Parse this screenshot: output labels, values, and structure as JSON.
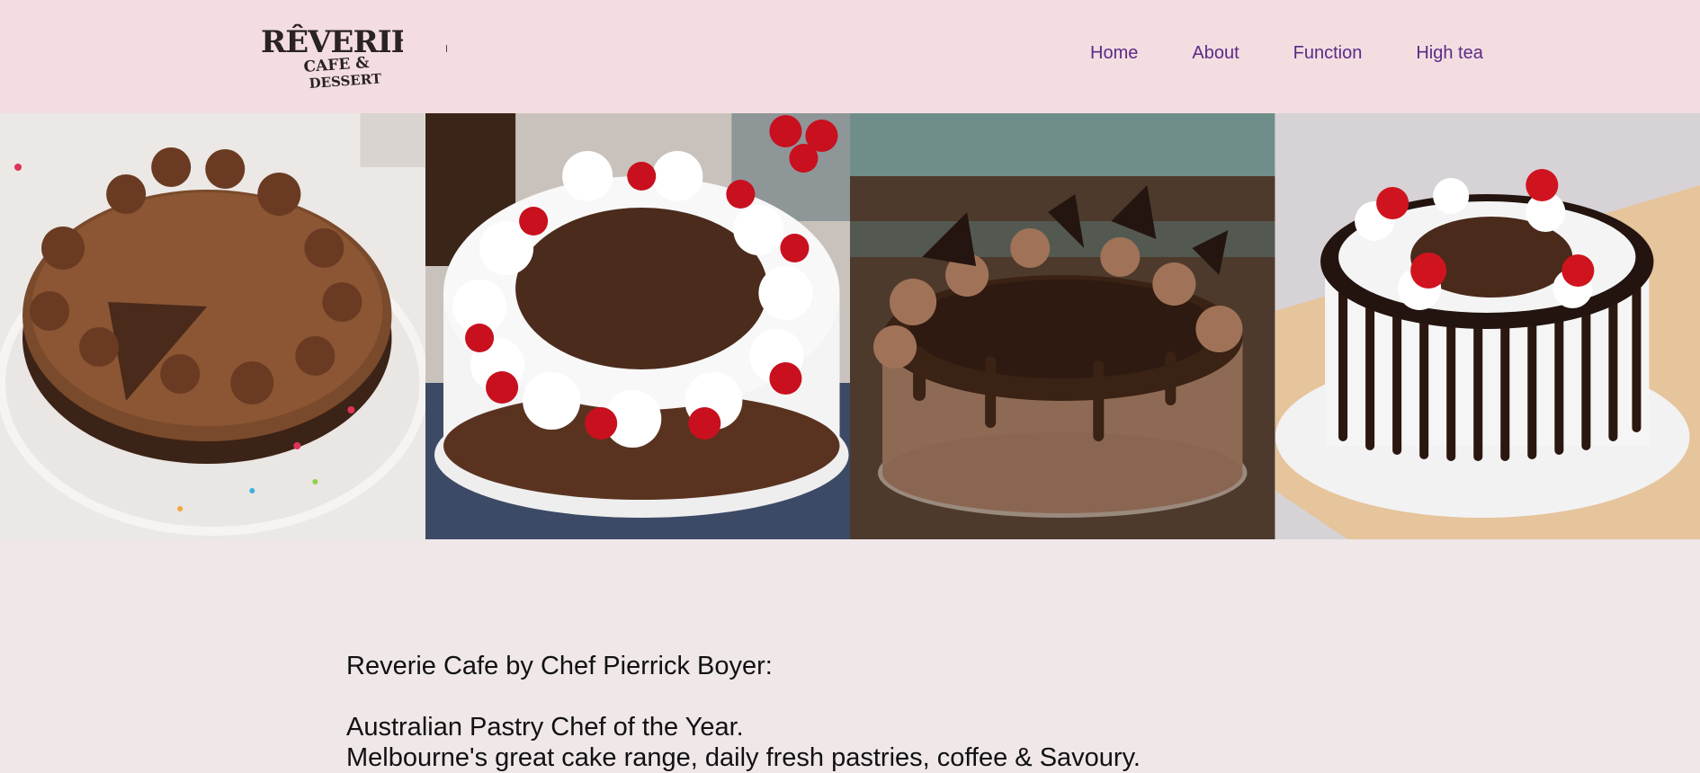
{
  "brand": {
    "name": "RÊVERIE",
    "tagline_line1": "CAFE &",
    "tagline_line2": "DESSERT"
  },
  "nav": {
    "items": [
      {
        "label": "Home"
      },
      {
        "label": "About"
      },
      {
        "label": "Function"
      },
      {
        "label": "High tea"
      }
    ]
  },
  "gallery": {
    "images": [
      {
        "name": "chocolate-sprinkle-cake-image"
      },
      {
        "name": "black-forest-cake-image"
      },
      {
        "name": "chocolate-drip-cake-image"
      },
      {
        "name": "cherry-striped-cake-image"
      }
    ]
  },
  "intro": {
    "heading": "Reverie Cafe by Chef Pierrick Boyer:",
    "line1": "Australian Pastry Chef of the Year.",
    "line2": "Melbourne's great cake range, daily fresh pastries, coffee & Savoury."
  },
  "colors": {
    "header_bg": "#f3dde1",
    "page_bg": "#efe7e8",
    "nav_link": "#5b2a86"
  }
}
